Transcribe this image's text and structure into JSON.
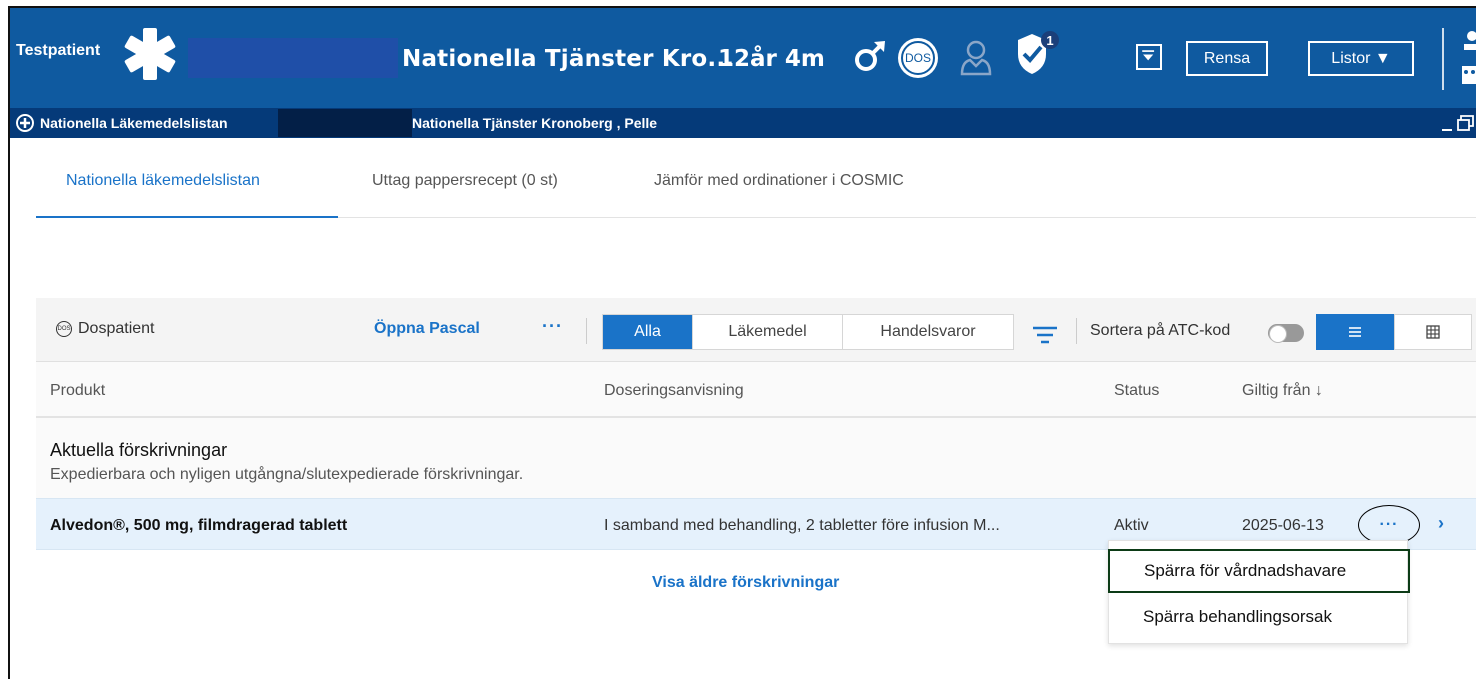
{
  "banner": {
    "patient_tag": "Testpatient",
    "title": "Nationella Tjänster Kro...",
    "age": "12år 4m",
    "dos_label": "DOS",
    "shield_badge": "1",
    "rensa_label": "Rensa",
    "listor_label": "Listor ▼"
  },
  "subbar": {
    "module": "Nationella Läkemedelslistan",
    "context": "Nationella Tjänster Kronoberg , Pelle"
  },
  "tabs": [
    {
      "label": "Nationella läkemedelslistan"
    },
    {
      "label": "Uttag pappersrecept (0 st)"
    },
    {
      "label": "Jämför med ordinationer i COSMIC"
    }
  ],
  "toolbar": {
    "dospatient": "Dospatient",
    "dos_circle": "DOS",
    "oppna": "Öppna Pascal",
    "more": "···",
    "segments": [
      "Alla",
      "Läkemedel",
      "Handelsvaror"
    ],
    "sortera": "Sortera på ATC-kod"
  },
  "columns": {
    "produkt": "Produkt",
    "dosering": "Doseringsanvisning",
    "status": "Status",
    "giltig": "Giltig från ↓"
  },
  "section": {
    "heading": "Aktuella förskrivningar",
    "subheading": "Expedierbara och nyligen utgångna/slutexpedierade förskrivningar."
  },
  "rows": [
    {
      "product": "Alvedon®, 500 mg, filmdragerad tablett",
      "dosering": "I samband med behandling, 2 tabletter före infusion M...",
      "status": "Aktiv",
      "date": "2025-06-13",
      "more": "···",
      "chevron": "›"
    }
  ],
  "visa": "Visa äldre förskrivningar",
  "menu": {
    "item1": "Spärra för vårdnadshavare",
    "item2": "Spärra behandlingsorsak"
  },
  "colors": {
    "banner": "#0f5aa0",
    "subbar": "#053a79",
    "accent": "#1a73c8",
    "row_highlight": "#e5f1fc"
  },
  "icons": [
    "star-of-life-icon",
    "male-icon",
    "dos-icon",
    "person-icon",
    "shield-check-icon",
    "filter-icon",
    "user-icon",
    "plus-circle-icon",
    "window-controls-icon",
    "list-view-icon",
    "grid-view-icon"
  ]
}
